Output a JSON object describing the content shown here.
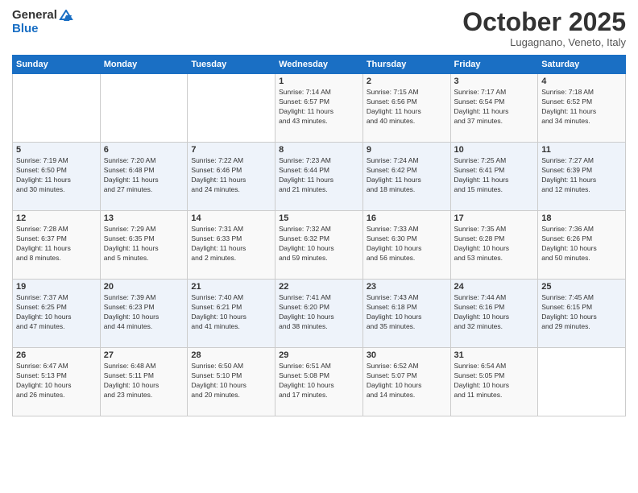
{
  "logo": {
    "line1": "General",
    "line2": "Blue"
  },
  "title": "October 2025",
  "location": "Lugagnano, Veneto, Italy",
  "days_of_week": [
    "Sunday",
    "Monday",
    "Tuesday",
    "Wednesday",
    "Thursday",
    "Friday",
    "Saturday"
  ],
  "weeks": [
    [
      {
        "day": "",
        "info": ""
      },
      {
        "day": "",
        "info": ""
      },
      {
        "day": "",
        "info": ""
      },
      {
        "day": "1",
        "info": "Sunrise: 7:14 AM\nSunset: 6:57 PM\nDaylight: 11 hours\nand 43 minutes."
      },
      {
        "day": "2",
        "info": "Sunrise: 7:15 AM\nSunset: 6:56 PM\nDaylight: 11 hours\nand 40 minutes."
      },
      {
        "day": "3",
        "info": "Sunrise: 7:17 AM\nSunset: 6:54 PM\nDaylight: 11 hours\nand 37 minutes."
      },
      {
        "day": "4",
        "info": "Sunrise: 7:18 AM\nSunset: 6:52 PM\nDaylight: 11 hours\nand 34 minutes."
      }
    ],
    [
      {
        "day": "5",
        "info": "Sunrise: 7:19 AM\nSunset: 6:50 PM\nDaylight: 11 hours\nand 30 minutes."
      },
      {
        "day": "6",
        "info": "Sunrise: 7:20 AM\nSunset: 6:48 PM\nDaylight: 11 hours\nand 27 minutes."
      },
      {
        "day": "7",
        "info": "Sunrise: 7:22 AM\nSunset: 6:46 PM\nDaylight: 11 hours\nand 24 minutes."
      },
      {
        "day": "8",
        "info": "Sunrise: 7:23 AM\nSunset: 6:44 PM\nDaylight: 11 hours\nand 21 minutes."
      },
      {
        "day": "9",
        "info": "Sunrise: 7:24 AM\nSunset: 6:42 PM\nDaylight: 11 hours\nand 18 minutes."
      },
      {
        "day": "10",
        "info": "Sunrise: 7:25 AM\nSunset: 6:41 PM\nDaylight: 11 hours\nand 15 minutes."
      },
      {
        "day": "11",
        "info": "Sunrise: 7:27 AM\nSunset: 6:39 PM\nDaylight: 11 hours\nand 12 minutes."
      }
    ],
    [
      {
        "day": "12",
        "info": "Sunrise: 7:28 AM\nSunset: 6:37 PM\nDaylight: 11 hours\nand 8 minutes."
      },
      {
        "day": "13",
        "info": "Sunrise: 7:29 AM\nSunset: 6:35 PM\nDaylight: 11 hours\nand 5 minutes."
      },
      {
        "day": "14",
        "info": "Sunrise: 7:31 AM\nSunset: 6:33 PM\nDaylight: 11 hours\nand 2 minutes."
      },
      {
        "day": "15",
        "info": "Sunrise: 7:32 AM\nSunset: 6:32 PM\nDaylight: 10 hours\nand 59 minutes."
      },
      {
        "day": "16",
        "info": "Sunrise: 7:33 AM\nSunset: 6:30 PM\nDaylight: 10 hours\nand 56 minutes."
      },
      {
        "day": "17",
        "info": "Sunrise: 7:35 AM\nSunset: 6:28 PM\nDaylight: 10 hours\nand 53 minutes."
      },
      {
        "day": "18",
        "info": "Sunrise: 7:36 AM\nSunset: 6:26 PM\nDaylight: 10 hours\nand 50 minutes."
      }
    ],
    [
      {
        "day": "19",
        "info": "Sunrise: 7:37 AM\nSunset: 6:25 PM\nDaylight: 10 hours\nand 47 minutes."
      },
      {
        "day": "20",
        "info": "Sunrise: 7:39 AM\nSunset: 6:23 PM\nDaylight: 10 hours\nand 44 minutes."
      },
      {
        "day": "21",
        "info": "Sunrise: 7:40 AM\nSunset: 6:21 PM\nDaylight: 10 hours\nand 41 minutes."
      },
      {
        "day": "22",
        "info": "Sunrise: 7:41 AM\nSunset: 6:20 PM\nDaylight: 10 hours\nand 38 minutes."
      },
      {
        "day": "23",
        "info": "Sunrise: 7:43 AM\nSunset: 6:18 PM\nDaylight: 10 hours\nand 35 minutes."
      },
      {
        "day": "24",
        "info": "Sunrise: 7:44 AM\nSunset: 6:16 PM\nDaylight: 10 hours\nand 32 minutes."
      },
      {
        "day": "25",
        "info": "Sunrise: 7:45 AM\nSunset: 6:15 PM\nDaylight: 10 hours\nand 29 minutes."
      }
    ],
    [
      {
        "day": "26",
        "info": "Sunrise: 6:47 AM\nSunset: 5:13 PM\nDaylight: 10 hours\nand 26 minutes."
      },
      {
        "day": "27",
        "info": "Sunrise: 6:48 AM\nSunset: 5:11 PM\nDaylight: 10 hours\nand 23 minutes."
      },
      {
        "day": "28",
        "info": "Sunrise: 6:50 AM\nSunset: 5:10 PM\nDaylight: 10 hours\nand 20 minutes."
      },
      {
        "day": "29",
        "info": "Sunrise: 6:51 AM\nSunset: 5:08 PM\nDaylight: 10 hours\nand 17 minutes."
      },
      {
        "day": "30",
        "info": "Sunrise: 6:52 AM\nSunset: 5:07 PM\nDaylight: 10 hours\nand 14 minutes."
      },
      {
        "day": "31",
        "info": "Sunrise: 6:54 AM\nSunset: 5:05 PM\nDaylight: 10 hours\nand 11 minutes."
      },
      {
        "day": "",
        "info": ""
      }
    ]
  ]
}
